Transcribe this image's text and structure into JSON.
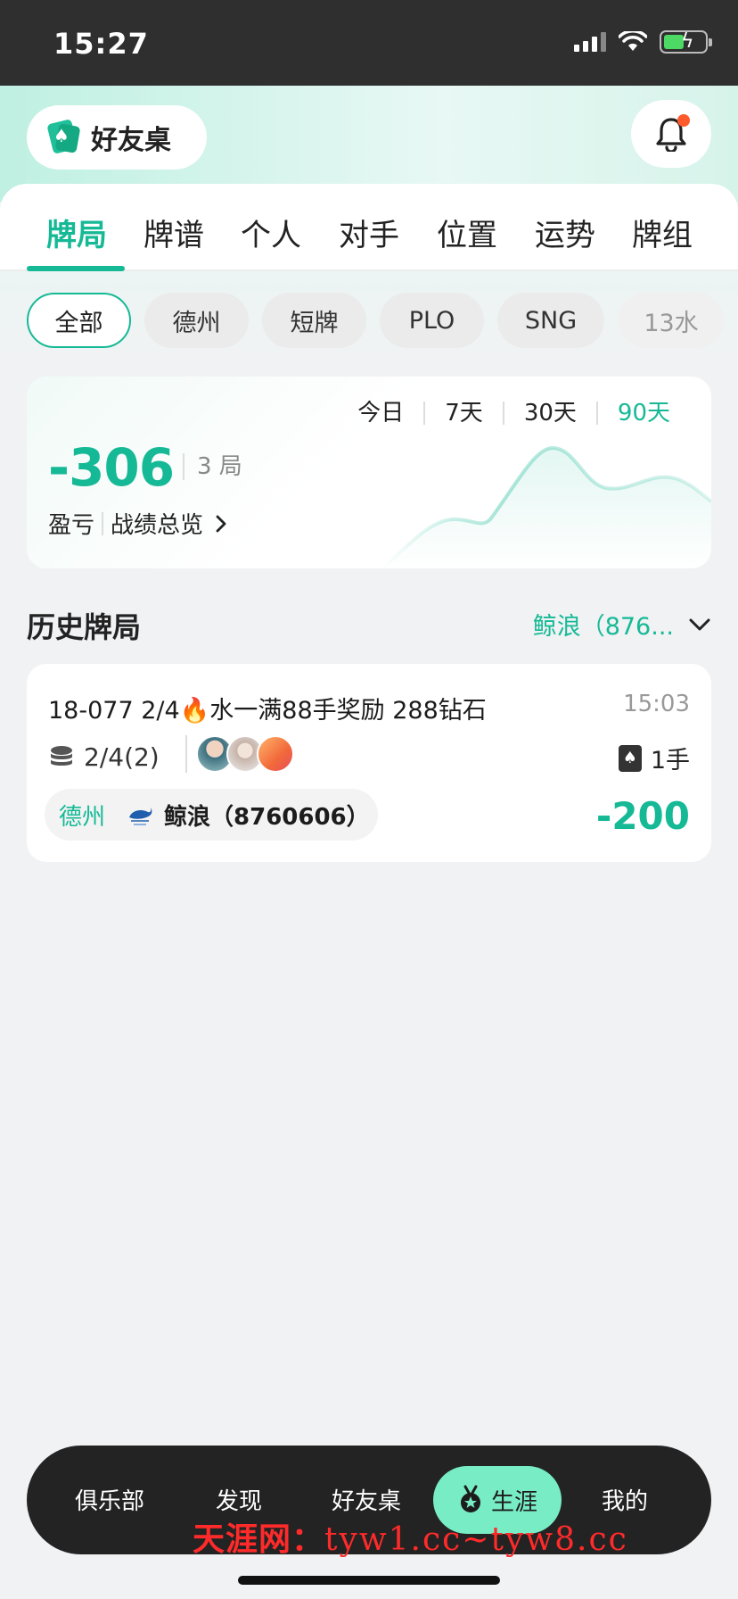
{
  "status_bar": {
    "time": "15:27"
  },
  "header": {
    "friend_table_label": "好友桌"
  },
  "tabs": [
    "牌局",
    "牌谱",
    "个人",
    "对手",
    "位置",
    "运势",
    "牌组"
  ],
  "filters": [
    "全部",
    "德州",
    "短牌",
    "PLO",
    "SNG",
    "13水"
  ],
  "summary": {
    "ranges": [
      "今日",
      "7天",
      "30天",
      "90天"
    ],
    "active_range": "90天",
    "profit_loss": "-306",
    "hand_count": "3 局",
    "pl_label": "盈亏",
    "overview_link": "战绩总览"
  },
  "history": {
    "title": "历史牌局",
    "club_filter": "鲸浪（876..."
  },
  "record": {
    "title_prefix": "18-077 2/4",
    "title_suffix": "水一满88手奖励 288钻石",
    "time": "15:03",
    "blinds": "2/4(2)",
    "hands": "1手",
    "game_type": "德州",
    "club": "鲸浪（8760606）",
    "result": "-200"
  },
  "bottom_nav": [
    "俱乐部",
    "发现",
    "好友桌",
    "生涯",
    "我的"
  ],
  "watermark": {
    "prefix": "天涯网：",
    "url": "tyw1.cc~tyw8.cc"
  },
  "colors": {
    "accent": "#16b996",
    "nav_active": "#78ecc5",
    "nav_bg": "#232323",
    "status_bar": "#2f2f2f"
  }
}
